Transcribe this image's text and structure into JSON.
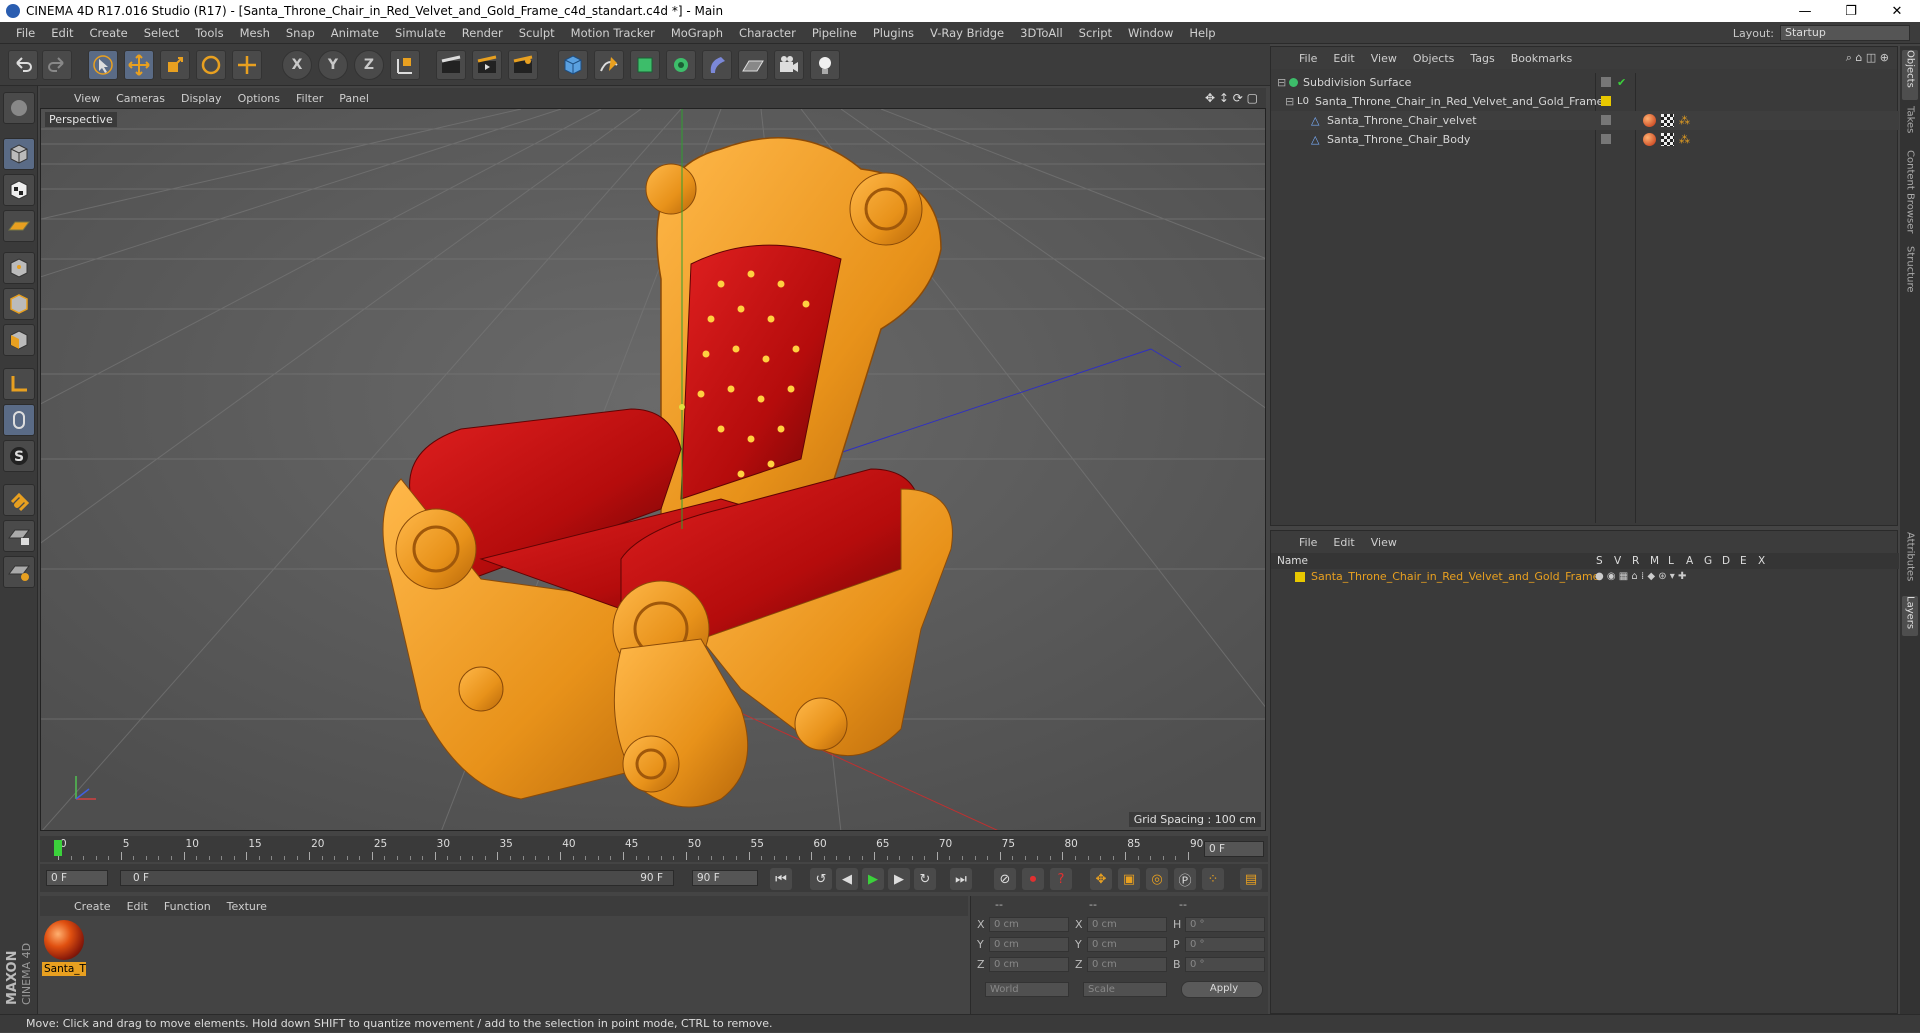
{
  "window": {
    "title": "CINEMA 4D R17.016 Studio (R17) - [Santa_Throne_Chair_in_Red_Velvet_and_Gold_Frame_c4d_standart.c4d *] - Main",
    "controls": [
      "—",
      "❐",
      "✕"
    ]
  },
  "menubar": {
    "items": [
      "File",
      "Edit",
      "Create",
      "Select",
      "Tools",
      "Mesh",
      "Snap",
      "Animate",
      "Simulate",
      "Render",
      "Sculpt",
      "Motion Tracker",
      "MoGraph",
      "Character",
      "Pipeline",
      "Plugins",
      "V-Ray Bridge",
      "3DToAll",
      "Script",
      "Window",
      "Help"
    ],
    "layout_label": "Layout:",
    "layout_value": "Startup"
  },
  "toolbar": {
    "x_label": "X",
    "y_label": "Y",
    "z_label": "Z"
  },
  "viewport": {
    "menu": [
      "View",
      "Cameras",
      "Display",
      "Options",
      "Filter",
      "Panel"
    ],
    "label": "Perspective",
    "grid_spacing": "Grid Spacing : 100 cm"
  },
  "timeline": {
    "ticks": [
      "0",
      "5",
      "10",
      "15",
      "20",
      "25",
      "30",
      "35",
      "40",
      "45",
      "50",
      "55",
      "60",
      "65",
      "70",
      "75",
      "80",
      "85",
      "90"
    ],
    "current_frame": "0 F",
    "start_field": "0 F",
    "range_start": "0 F",
    "range_end": "90 F",
    "end_field": "90 F"
  },
  "material_manager": {
    "menu": [
      "Create",
      "Edit",
      "Function",
      "Texture"
    ],
    "material_name": "Santa_T"
  },
  "coordinates": {
    "headers": [
      "--",
      "--",
      "--"
    ],
    "rows": [
      {
        "axis": "X",
        "pos": "0 cm",
        "axis2": "X",
        "size": "0 cm",
        "rot_label": "H",
        "rot": "0 °"
      },
      {
        "axis": "Y",
        "pos": "0 cm",
        "axis2": "Y",
        "size": "0 cm",
        "rot_label": "P",
        "rot": "0 °"
      },
      {
        "axis": "Z",
        "pos": "0 cm",
        "axis2": "Z",
        "size": "0 cm",
        "rot_label": "B",
        "rot": "0 °"
      }
    ],
    "mode1": "World",
    "mode2": "Scale",
    "apply": "Apply"
  },
  "object_manager": {
    "menu": [
      "File",
      "Edit",
      "View",
      "Objects",
      "Tags",
      "Bookmarks"
    ],
    "objects": [
      {
        "name": "Subdivision Surface"
      },
      {
        "name": "Santa_Throne_Chair_in_Red_Velvet_and_Gold_Frame"
      },
      {
        "name": "Santa_Throne_Chair_velvet"
      },
      {
        "name": "Santa_Throne_Chair_Body"
      }
    ]
  },
  "layer_manager": {
    "menu": [
      "File",
      "Edit",
      "View"
    ],
    "name_header": "Name",
    "flags": [
      "S",
      "V",
      "R",
      "M",
      "L",
      "A",
      "G",
      "D",
      "E",
      "X"
    ],
    "layer_name": "Santa_Throne_Chair_in_Red_Velvet_and_Gold_Frame",
    "layer_color": "#e8c800"
  },
  "right_tabs": [
    "Objects",
    "Takes",
    "Content Browser",
    "Structure",
    "Attributes",
    "Layers"
  ],
  "status": "Move: Click and drag to move elements. Hold down SHIFT to quantize movement / add to the selection in point mode, CTRL to remove.",
  "brand": "MAXON CINEMA 4D",
  "colors": {
    "accent": "#e8a020",
    "gold": "#e8961c",
    "velvet": "#b01010"
  }
}
